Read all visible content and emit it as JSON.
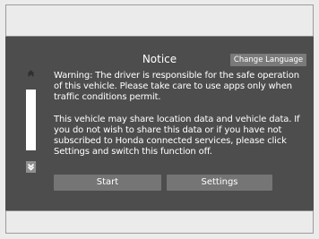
{
  "dialog": {
    "title": "Notice",
    "change_language_label": "Change Language",
    "paragraph_1": "Warning: The driver is responsible for the safe operation of this vehicle. Please take care to use apps only when traffic conditions permit.",
    "paragraph_2": "This vehicle may share location data and vehicle data. If you do not wish to share this data or if you have not subscribed to Honda connected services, please click Settings and switch this function off.",
    "start_label": "Start",
    "settings_label": "Settings"
  },
  "scrollbar": {
    "up_icon": "chevron-up-icon",
    "down_icon": "chevron-down-icon"
  },
  "colors": {
    "screen_background": "#4d4d4d",
    "button_background": "#757575",
    "text": "#ffffff"
  }
}
